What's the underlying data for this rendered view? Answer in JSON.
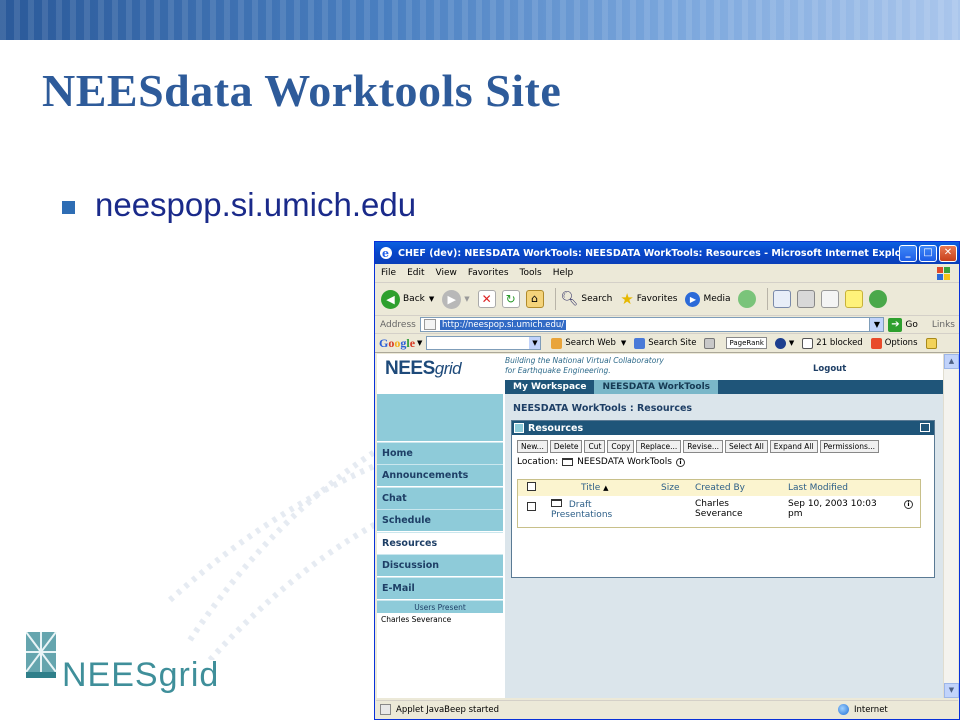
{
  "slide": {
    "title": "NEESdata Worktools Site",
    "bullet": "neespop.si.umich.edu",
    "logo_text": "NEESgrid"
  },
  "browser": {
    "window_title": "CHEF (dev): NEESDATA WorkTools: NEESDATA WorkTools: Resources - Microsoft Internet Explorer",
    "menu": [
      "File",
      "Edit",
      "View",
      "Favorites",
      "Tools",
      "Help"
    ],
    "toolbar": {
      "back": "Back",
      "search": "Search",
      "favorites": "Favorites",
      "media": "Media"
    },
    "address": {
      "label": "Address",
      "url": "http://neespop.si.umich.edu/",
      "go": "Go",
      "links": "Links"
    },
    "google_bar": {
      "logo": "Google",
      "search_web": "Search Web",
      "search_site": "Search Site",
      "pagerank": "PageRank",
      "blocked": "21 blocked",
      "options": "Options"
    },
    "status": {
      "text": "Applet JavaBeep started",
      "zone": "Internet"
    }
  },
  "portal": {
    "logo": "NEES",
    "logo_suffix": "grid",
    "tagline_1": "Building the National Virtual Collaboratory",
    "tagline_2": "for Earthquake Engineering.",
    "logout": "Logout",
    "tabs": [
      {
        "label": "My Workspace",
        "active": false
      },
      {
        "label": "NEESDATA WorkTools",
        "active": true
      }
    ],
    "nav": [
      {
        "label": "Home",
        "selected": false
      },
      {
        "label": "Announcements",
        "selected": false
      },
      {
        "label": "Chat",
        "selected": false
      },
      {
        "label": "Schedule",
        "selected": false
      },
      {
        "label": "Resources",
        "selected": true
      },
      {
        "label": "Discussion",
        "selected": false
      },
      {
        "label": "E-Mail",
        "selected": false
      }
    ],
    "users_present_label": "Users Present",
    "users_present": [
      "Charles Severance"
    ],
    "breadcrumb": "NEESDATA WorkTools : Resources",
    "resources": {
      "header": "Resources",
      "buttons": [
        "New...",
        "Delete",
        "Cut",
        "Copy",
        "Replace...",
        "Revise...",
        "Select All",
        "Expand All",
        "Permissions..."
      ],
      "location_label": "Location:",
      "location_value": "NEESDATA WorkTools",
      "columns": {
        "title": "Title",
        "size": "Size",
        "created_by": "Created By",
        "last_modified": "Last Modified"
      },
      "rows": [
        {
          "title_1": "Draft",
          "title_2": "Presentations",
          "size": "",
          "created_by_1": "Charles",
          "created_by_2": "Severance",
          "modified_1": "Sep 10, 2003 10:03",
          "modified_2": "pm"
        }
      ]
    }
  },
  "colors": {
    "slide_title": "#2e5b9a",
    "portal_dark": "#1f5579",
    "portal_light": "#8ecbd9",
    "xp_titlebar": "#0846c9"
  }
}
